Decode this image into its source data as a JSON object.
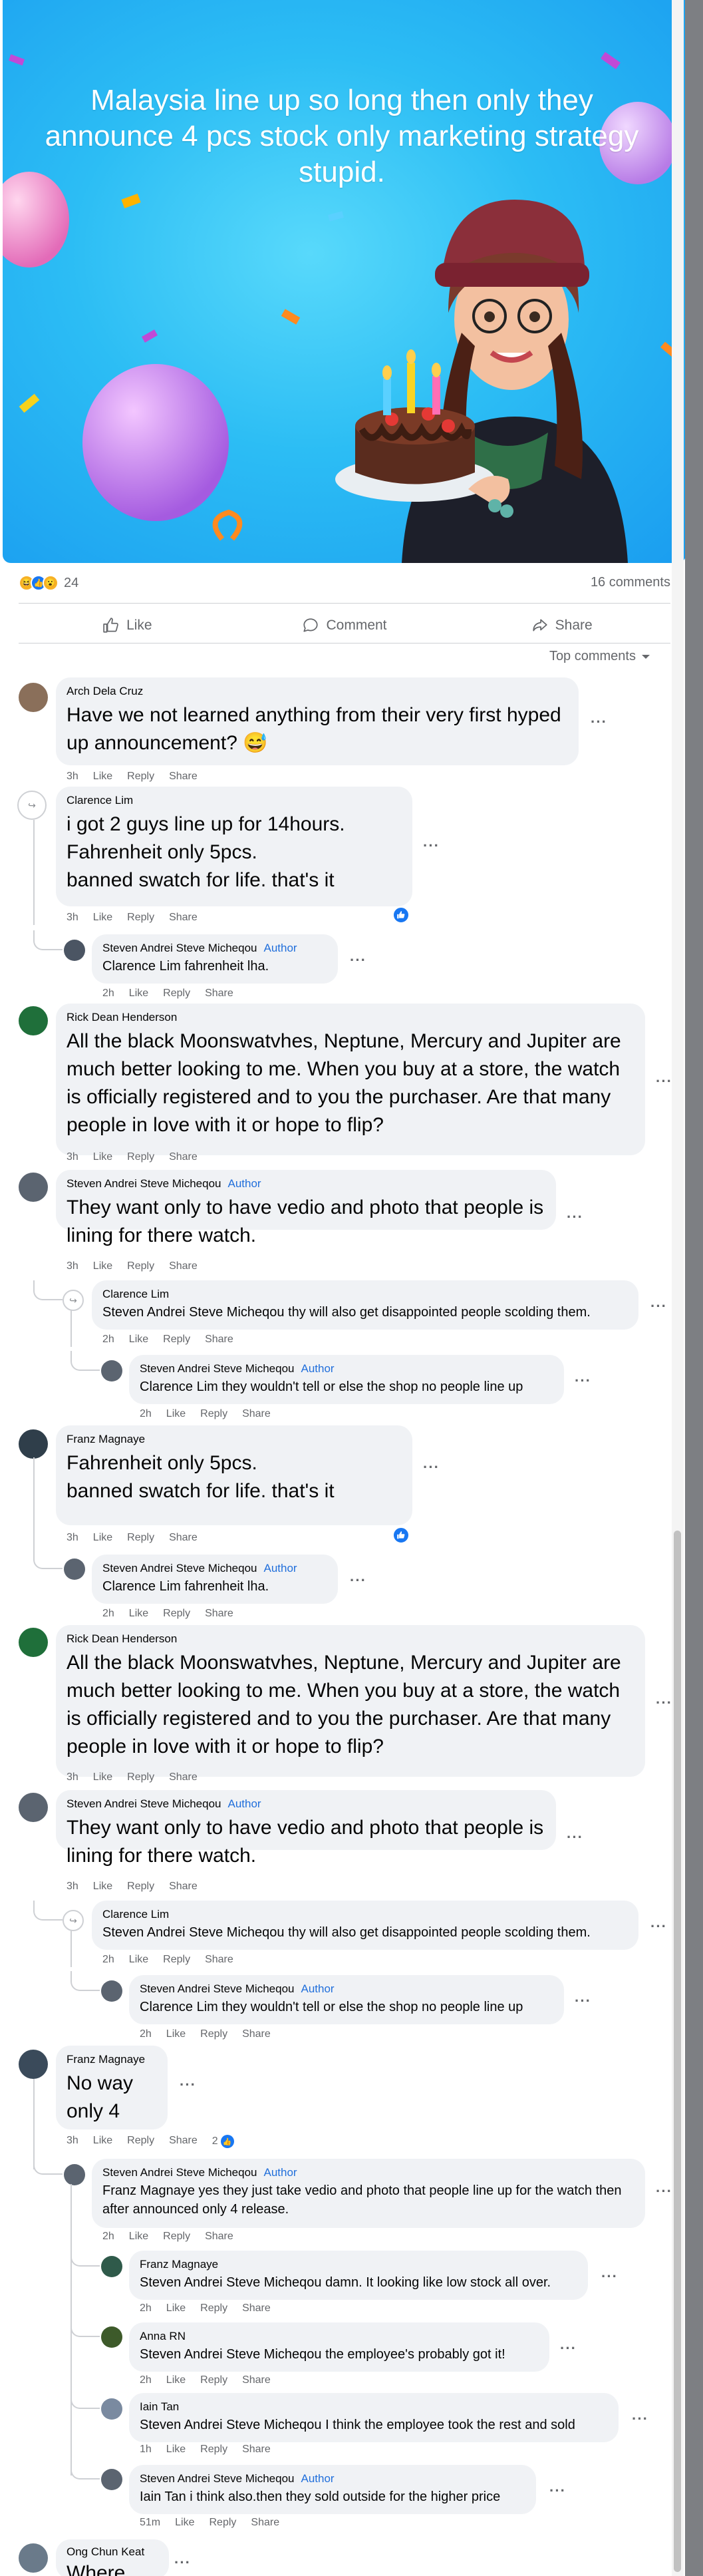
{
  "banner": {
    "text": "Malaysia line up so long then only they announce 4 pcs stock only marketing strategy stupid."
  },
  "stats": {
    "reaction_count": "24",
    "comment_count": "16 comments"
  },
  "actions": {
    "like": "Like",
    "comment": "Comment",
    "share": "Share"
  },
  "sort": {
    "label": "Top comments"
  },
  "labels": {
    "like": "Like",
    "reply": "Reply",
    "share": "Share",
    "author": "Author"
  },
  "comments": [
    {
      "name": "Arch Dela Cruz",
      "text": "Have we not learned anything from their very first hyped up announcement? 😅",
      "time": "3h"
    },
    {
      "name": "Clarence Lim",
      "text": "i got 2 guys line up for 14hours.\nFahrenheit only 5pcs.\nbanned swatch for life. that's it",
      "time": "3h"
    },
    {
      "name": "Steven Andrei Steve Micheqou",
      "text": "Clarence Lim fahrenheit lha.",
      "time": "2h"
    },
    {
      "name": "Rick Dean Henderson",
      "text": "All the black Moonswatvhes, Neptune, Mercury and Jupiter are much better looking to me. When you buy at a store, the watch is officially registered and to you the purchaser. Are that many people in love with it or hope to flip?",
      "time": "3h"
    },
    {
      "name": "Steven Andrei Steve Micheqou",
      "text": "They want only to have vedio and photo that people is lining for there watch.",
      "time": "3h"
    },
    {
      "name": "Clarence Lim",
      "text": "Steven Andrei Steve Micheqou thy will also get disappointed people scolding them.",
      "time": "2h"
    },
    {
      "name": "Steven Andrei Steve Micheqou",
      "text": "Clarence Lim they wouldn't tell or else the shop no people line up",
      "time": "2h"
    },
    {
      "name": "Franz Magnaye",
      "text": "Fahrenheit only 5pcs.\nbanned swatch for life. that's it",
      "time": "3h"
    },
    {
      "name": "Steven Andrei Steve Micheqou",
      "text": "Clarence Lim fahrenheit lha.",
      "time": "2h"
    },
    {
      "name": "Rick Dean Henderson",
      "text": "All the black Moonswatvhes, Neptune, Mercury and Jupiter are much better looking to me. When you buy at a store, the watch is officially registered and to you the purchaser. Are that many people in love with it or hope to flip?",
      "time": "3h"
    },
    {
      "name": "Steven Andrei Steve Micheqou",
      "text": "They want only to have vedio and photo that people is lining for there watch.",
      "time": "3h"
    },
    {
      "name": "Clarence Lim",
      "text": "Steven Andrei Steve Micheqou thy will also get disappointed people scolding them.",
      "time": "2h"
    },
    {
      "name": "Steven Andrei Steve Micheqou",
      "text": "Clarence Lim they wouldn't tell or else the shop no people line up",
      "time": "2h"
    },
    {
      "name": "Franz Magnaye",
      "text": "No way\nonly 4",
      "time": "3h",
      "likes": "2"
    },
    {
      "name": "Steven Andrei Steve Micheqou",
      "text": "Franz Magnaye yes they just take vedio and photo that people line up for the watch then after announced only 4 release.",
      "time": "2h"
    },
    {
      "name": "Franz Magnaye",
      "text": "Steven Andrei Steve Micheqou damn. It looking like low stock all over.",
      "time": "2h"
    },
    {
      "name": "Anna RN",
      "text": "Steven Andrei Steve Micheqou the employee's probably got it!",
      "time": "2h"
    },
    {
      "name": "Iain Tan",
      "text": "Steven Andrei Steve Micheqou I think the employee took the rest and sold",
      "time": "1h"
    },
    {
      "name": "Steven Andrei Steve Micheqou",
      "text": "Iain Tan i think also.then they sold outside for the higher price",
      "time": "51m"
    },
    {
      "name": "Ong Chun Keat",
      "text": "Where",
      "time": ""
    }
  ],
  "colors": {
    "author_badge": "#216fdb",
    "like_blue": "#1877f2",
    "bubble": "#f0f2f5",
    "meta_grey": "#65676b"
  }
}
